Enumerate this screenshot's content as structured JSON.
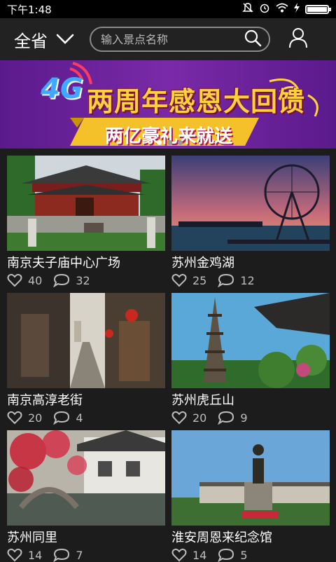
{
  "status_bar": {
    "time": "下午1:48"
  },
  "header": {
    "province_label": "全省",
    "search_placeholder": "输入景点名称"
  },
  "banner": {
    "network": "4G",
    "headline": "两周年感恩大回馈",
    "subline": "两亿豪礼来就送",
    "colors": {
      "background": "#6a1f98",
      "headline": "#ffd23c",
      "ribbon": "#f5c12a"
    }
  },
  "spots": [
    {
      "name": "南京夫子庙中心广场",
      "likes": "40",
      "comments": "32"
    },
    {
      "name": "苏州金鸡湖",
      "likes": "25",
      "comments": "12"
    },
    {
      "name": "南京高淳老街",
      "likes": "20",
      "comments": "4"
    },
    {
      "name": "苏州虎丘山",
      "likes": "20",
      "comments": "9"
    },
    {
      "name": "苏州同里",
      "likes": "14",
      "comments": "7"
    },
    {
      "name": "淮安周恩来纪念馆",
      "likes": "14",
      "comments": "5"
    }
  ]
}
